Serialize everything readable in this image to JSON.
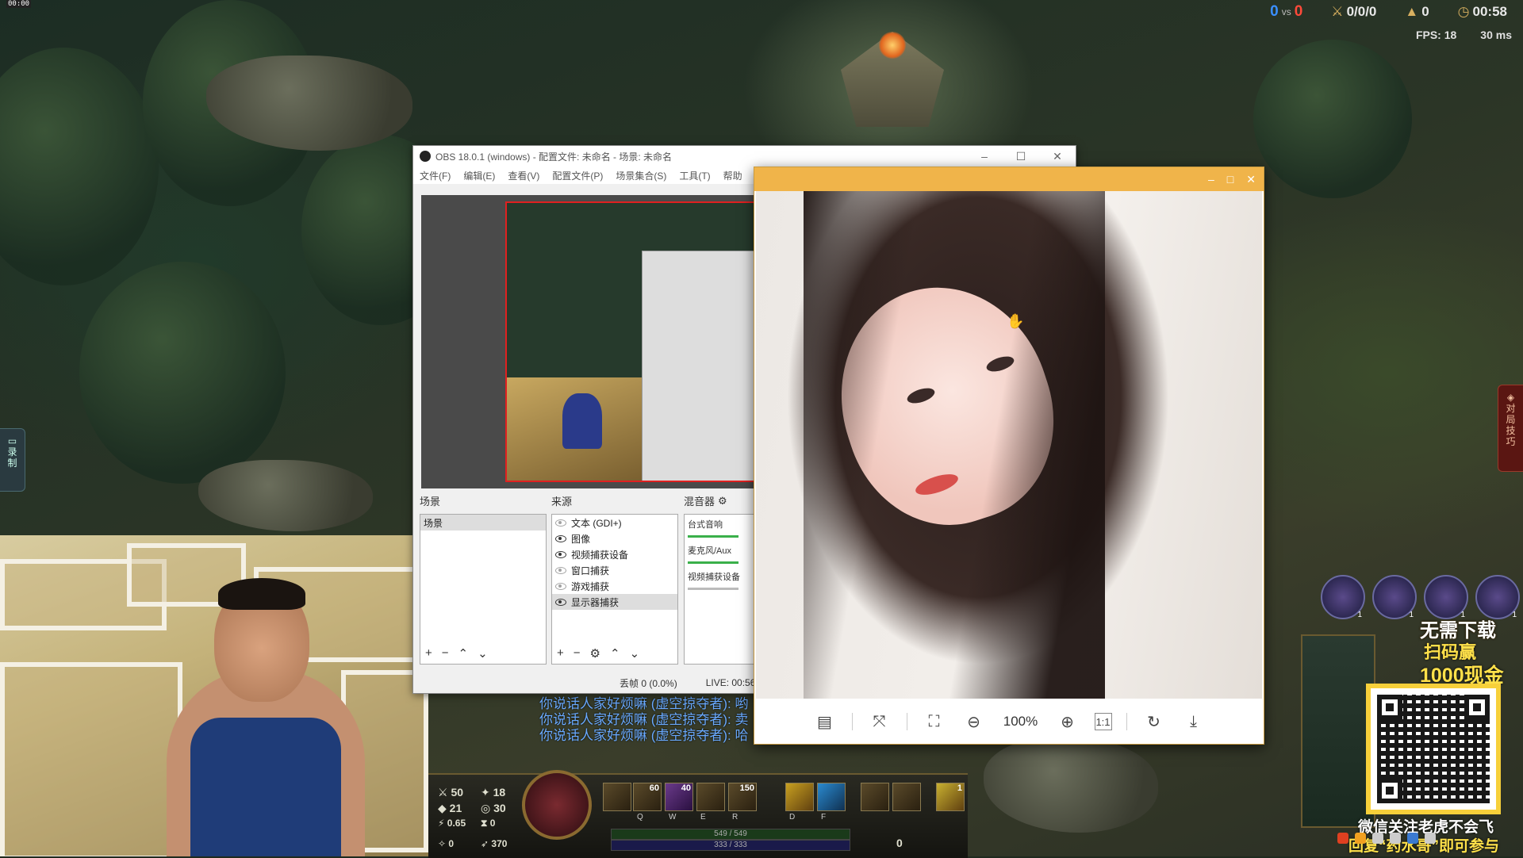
{
  "corner_timer": "00:00",
  "hud": {
    "score_blue": "0",
    "score_vs": "vs",
    "score_red": "0",
    "kda": "0/0/0",
    "cs": "0",
    "game_time": "00:58",
    "fps_label": "FPS:",
    "fps_value": "18",
    "ping": "30 ms"
  },
  "record_tab": {
    "label1": "录",
    "label2": "制"
  },
  "tip_tab": {
    "label1": "对",
    "label2": "局",
    "label3": "技",
    "label4": "巧"
  },
  "obs": {
    "title": "OBS 18.0.1 (windows) - 配置文件: 未命名 - 场景: 未命名",
    "menu": [
      "文件(F)",
      "编辑(E)",
      "查看(V)",
      "配置文件(P)",
      "场景集合(S)",
      "工具(T)",
      "帮助"
    ],
    "scenes_label": "场景",
    "sources_label": "来源",
    "mixer_label": "混音器",
    "scenes": [
      "场景"
    ],
    "sources": [
      {
        "name": "文本 (GDI+)",
        "visible": false
      },
      {
        "name": "图像",
        "visible": true
      },
      {
        "name": "视频捕获设备",
        "visible": true
      },
      {
        "name": "窗口捕获",
        "visible": false
      },
      {
        "name": "游戏捕获",
        "visible": false
      },
      {
        "name": "显示器捕获",
        "visible": true
      }
    ],
    "mixer": [
      "台式音响",
      "麦克风/Aux",
      "视频捕获设备"
    ],
    "status_dropped": "丢帧 0 (0.0%)",
    "status_live": "LIVE: 00:56"
  },
  "viewer": {
    "zoom": "100%",
    "minimize": "–",
    "maximize": "□",
    "close": "✕"
  },
  "chat": [
    "你说话人家好烦嘛 (虚空掠夺者): 哟",
    "你说话人家好烦嘛 (虚空掠夺者): 卖",
    "你说话人家好烦嘛 (虚空掠夺者): 哈"
  ],
  "bottom_hud": {
    "ad": "50",
    "ap": "18",
    "armor": "21",
    "mr": "30",
    "as": "0.65",
    "cdr": "0",
    "crit": "0",
    "ms": "370",
    "q_cd": "60",
    "w_cd": "40",
    "r_cd": "150",
    "q_key": "Q",
    "w_key": "W",
    "e_key": "E",
    "r_key": "R",
    "d_key": "D",
    "f_key": "F",
    "health": "549 / 549",
    "mana": "333 / 333",
    "gold": "0",
    "ward_count": "1"
  },
  "teammates": [
    "1",
    "1",
    "1",
    "1"
  ],
  "promo": {
    "line1": "无需下载",
    "line2": "扫码赢",
    "line3": "1000现金",
    "footer1": "微信关注老虎不会飞",
    "footer2": "回复“药水哥”即可参与"
  },
  "colors": {
    "accent_orange": "#f0b44a",
    "obs_selection_red": "#e02020",
    "chat_blue": "#6aaaff",
    "promo_yellow": "#ffe14a"
  }
}
